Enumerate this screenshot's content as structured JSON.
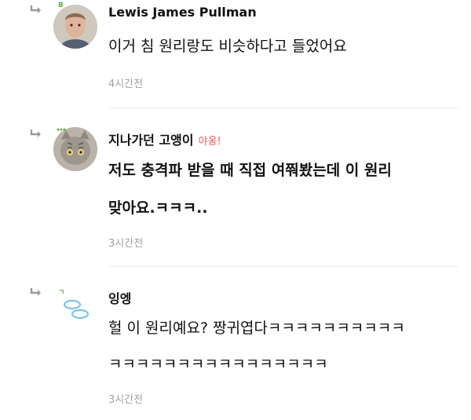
{
  "comments": [
    {
      "author": "Lewis James Pullman",
      "author_note": "",
      "lines": [
        "이거 침 원리랑도 비슷하다고 들었어요"
      ],
      "time": "4시간전",
      "badge": "B",
      "badge_color": "#6aa84f"
    },
    {
      "author": "지나가던 고앵이",
      "author_note": "야옹!",
      "lines": [
        "저도 충격파 받을 때 직접 여쭤봤는데 이 원리",
        "맞아요.ㅋㅋㅋ.."
      ],
      "time": "3시간전",
      "badge": "",
      "badge_color": "#6aa84f"
    },
    {
      "author": "잉엥",
      "author_note": "",
      "lines": [
        "헐 이 원리예요? 짱귀엽다ㅋㅋㅋㅋㅋㅋㅋㅋㅋㅋ",
        "ㅋㅋㅋㅋㅋㅋㅋㅋㅋㅋㅋㅋㅋㅋㅋㅋ"
      ],
      "time": "3시간전",
      "badge": "ㄱ",
      "badge_color": "#6aa84f"
    }
  ],
  "icons": {
    "reply": "reply-arrow-icon",
    "avatar_bubbles_color": "#7ec4e8"
  }
}
